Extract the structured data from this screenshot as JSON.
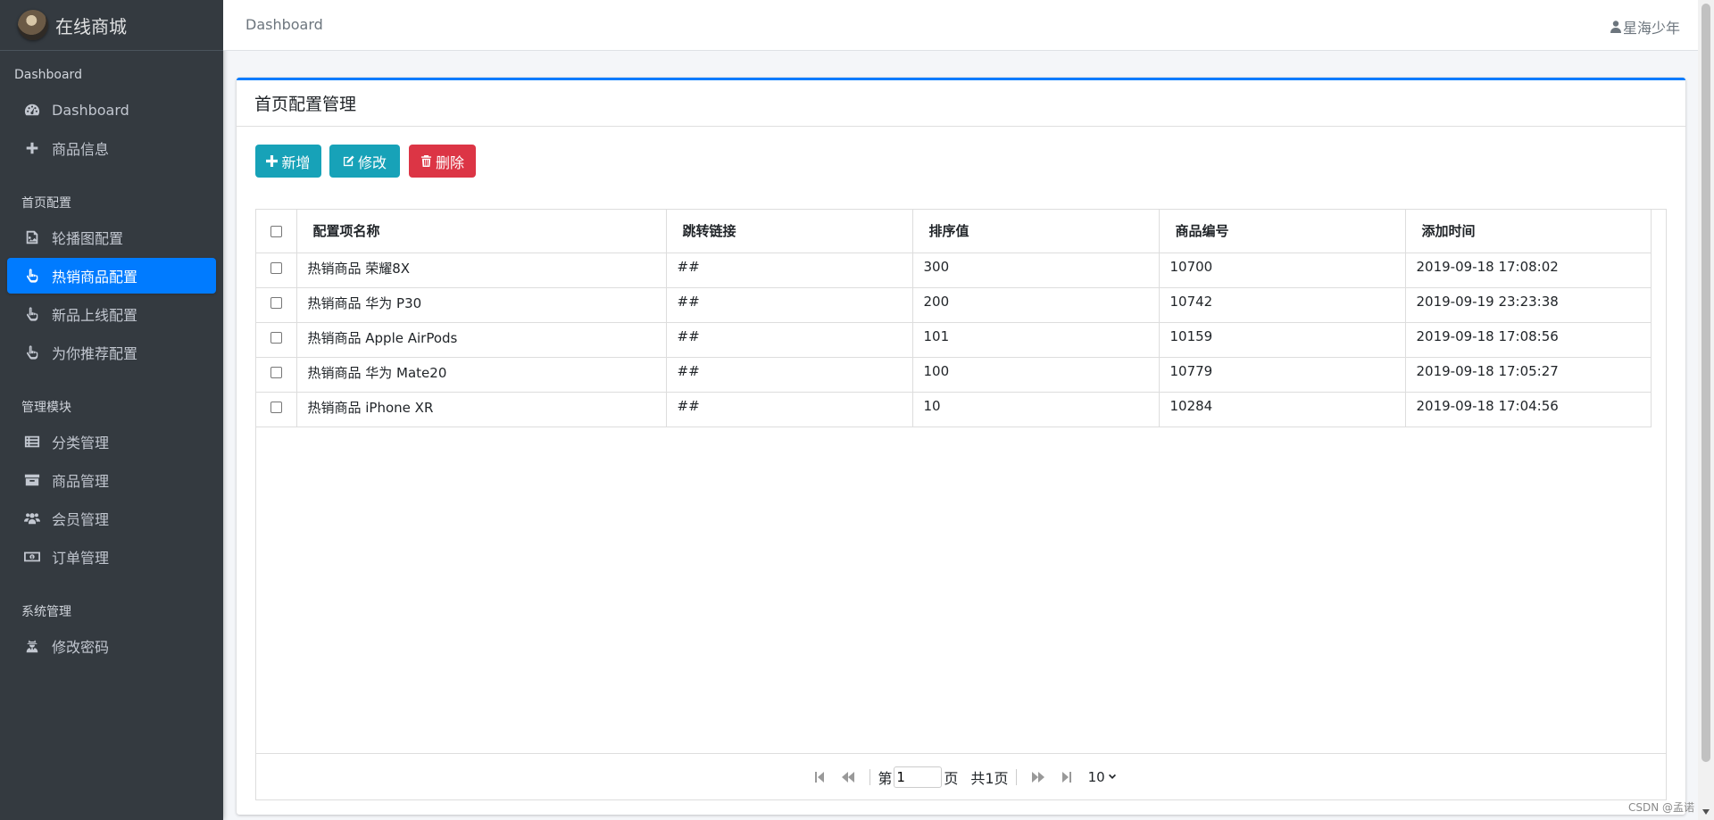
{
  "brand": {
    "name": "在线商城"
  },
  "sidebar": {
    "sections": [
      {
        "header": "Dashboard"
      },
      {
        "header": "首页配置"
      },
      {
        "header": "管理模块"
      },
      {
        "header": "系统管理"
      }
    ],
    "items": [
      {
        "label": "Dashboard",
        "icon": "tachometer-icon"
      },
      {
        "label": "商品信息",
        "icon": "plus-icon"
      },
      {
        "label": "轮播图配置",
        "icon": "image-icon"
      },
      {
        "label": "热销商品配置",
        "icon": "hand-pointer-icon",
        "active": true
      },
      {
        "label": "新品上线配置",
        "icon": "hand-pointer-icon"
      },
      {
        "label": "为你推荐配置",
        "icon": "hand-pointer-icon"
      },
      {
        "label": "分类管理",
        "icon": "list-icon"
      },
      {
        "label": "商品管理",
        "icon": "archive-icon"
      },
      {
        "label": "会员管理",
        "icon": "users-icon"
      },
      {
        "label": "订单管理",
        "icon": "money-icon"
      },
      {
        "label": "修改密码",
        "icon": "user-secret-icon"
      }
    ]
  },
  "topbar": {
    "breadcrumb": "Dashboard",
    "username": "星海少年"
  },
  "card": {
    "title": "首页配置管理",
    "buttons": {
      "add": "新增",
      "edit": "修改",
      "delete": "删除"
    }
  },
  "table": {
    "columns": [
      "配置项名称",
      "跳转链接",
      "排序值",
      "商品编号",
      "添加时间"
    ],
    "rows": [
      [
        "热销商品 荣耀8X",
        "##",
        "300",
        "10700",
        "2019-09-18 17:08:02"
      ],
      [
        "热销商品 华为 P30",
        "##",
        "200",
        "10742",
        "2019-09-19 23:23:38"
      ],
      [
        "热销商品 Apple AirPods",
        "##",
        "101",
        "10159",
        "2019-09-18 17:08:56"
      ],
      [
        "热销商品 华为 Mate20",
        "##",
        "100",
        "10779",
        "2019-09-18 17:05:27"
      ],
      [
        "热销商品 iPhone XR",
        "##",
        "10",
        "10284",
        "2019-09-18 17:04:56"
      ]
    ]
  },
  "pager": {
    "prefix": "第",
    "page_value": "1",
    "suffix": "页",
    "total": "共1页",
    "page_size": "10"
  },
  "watermark": "CSDN @孟诺",
  "colors": {
    "primary": "#007bff",
    "info": "#17a2b8",
    "danger": "#dc3545",
    "sidebar": "#343a40"
  }
}
